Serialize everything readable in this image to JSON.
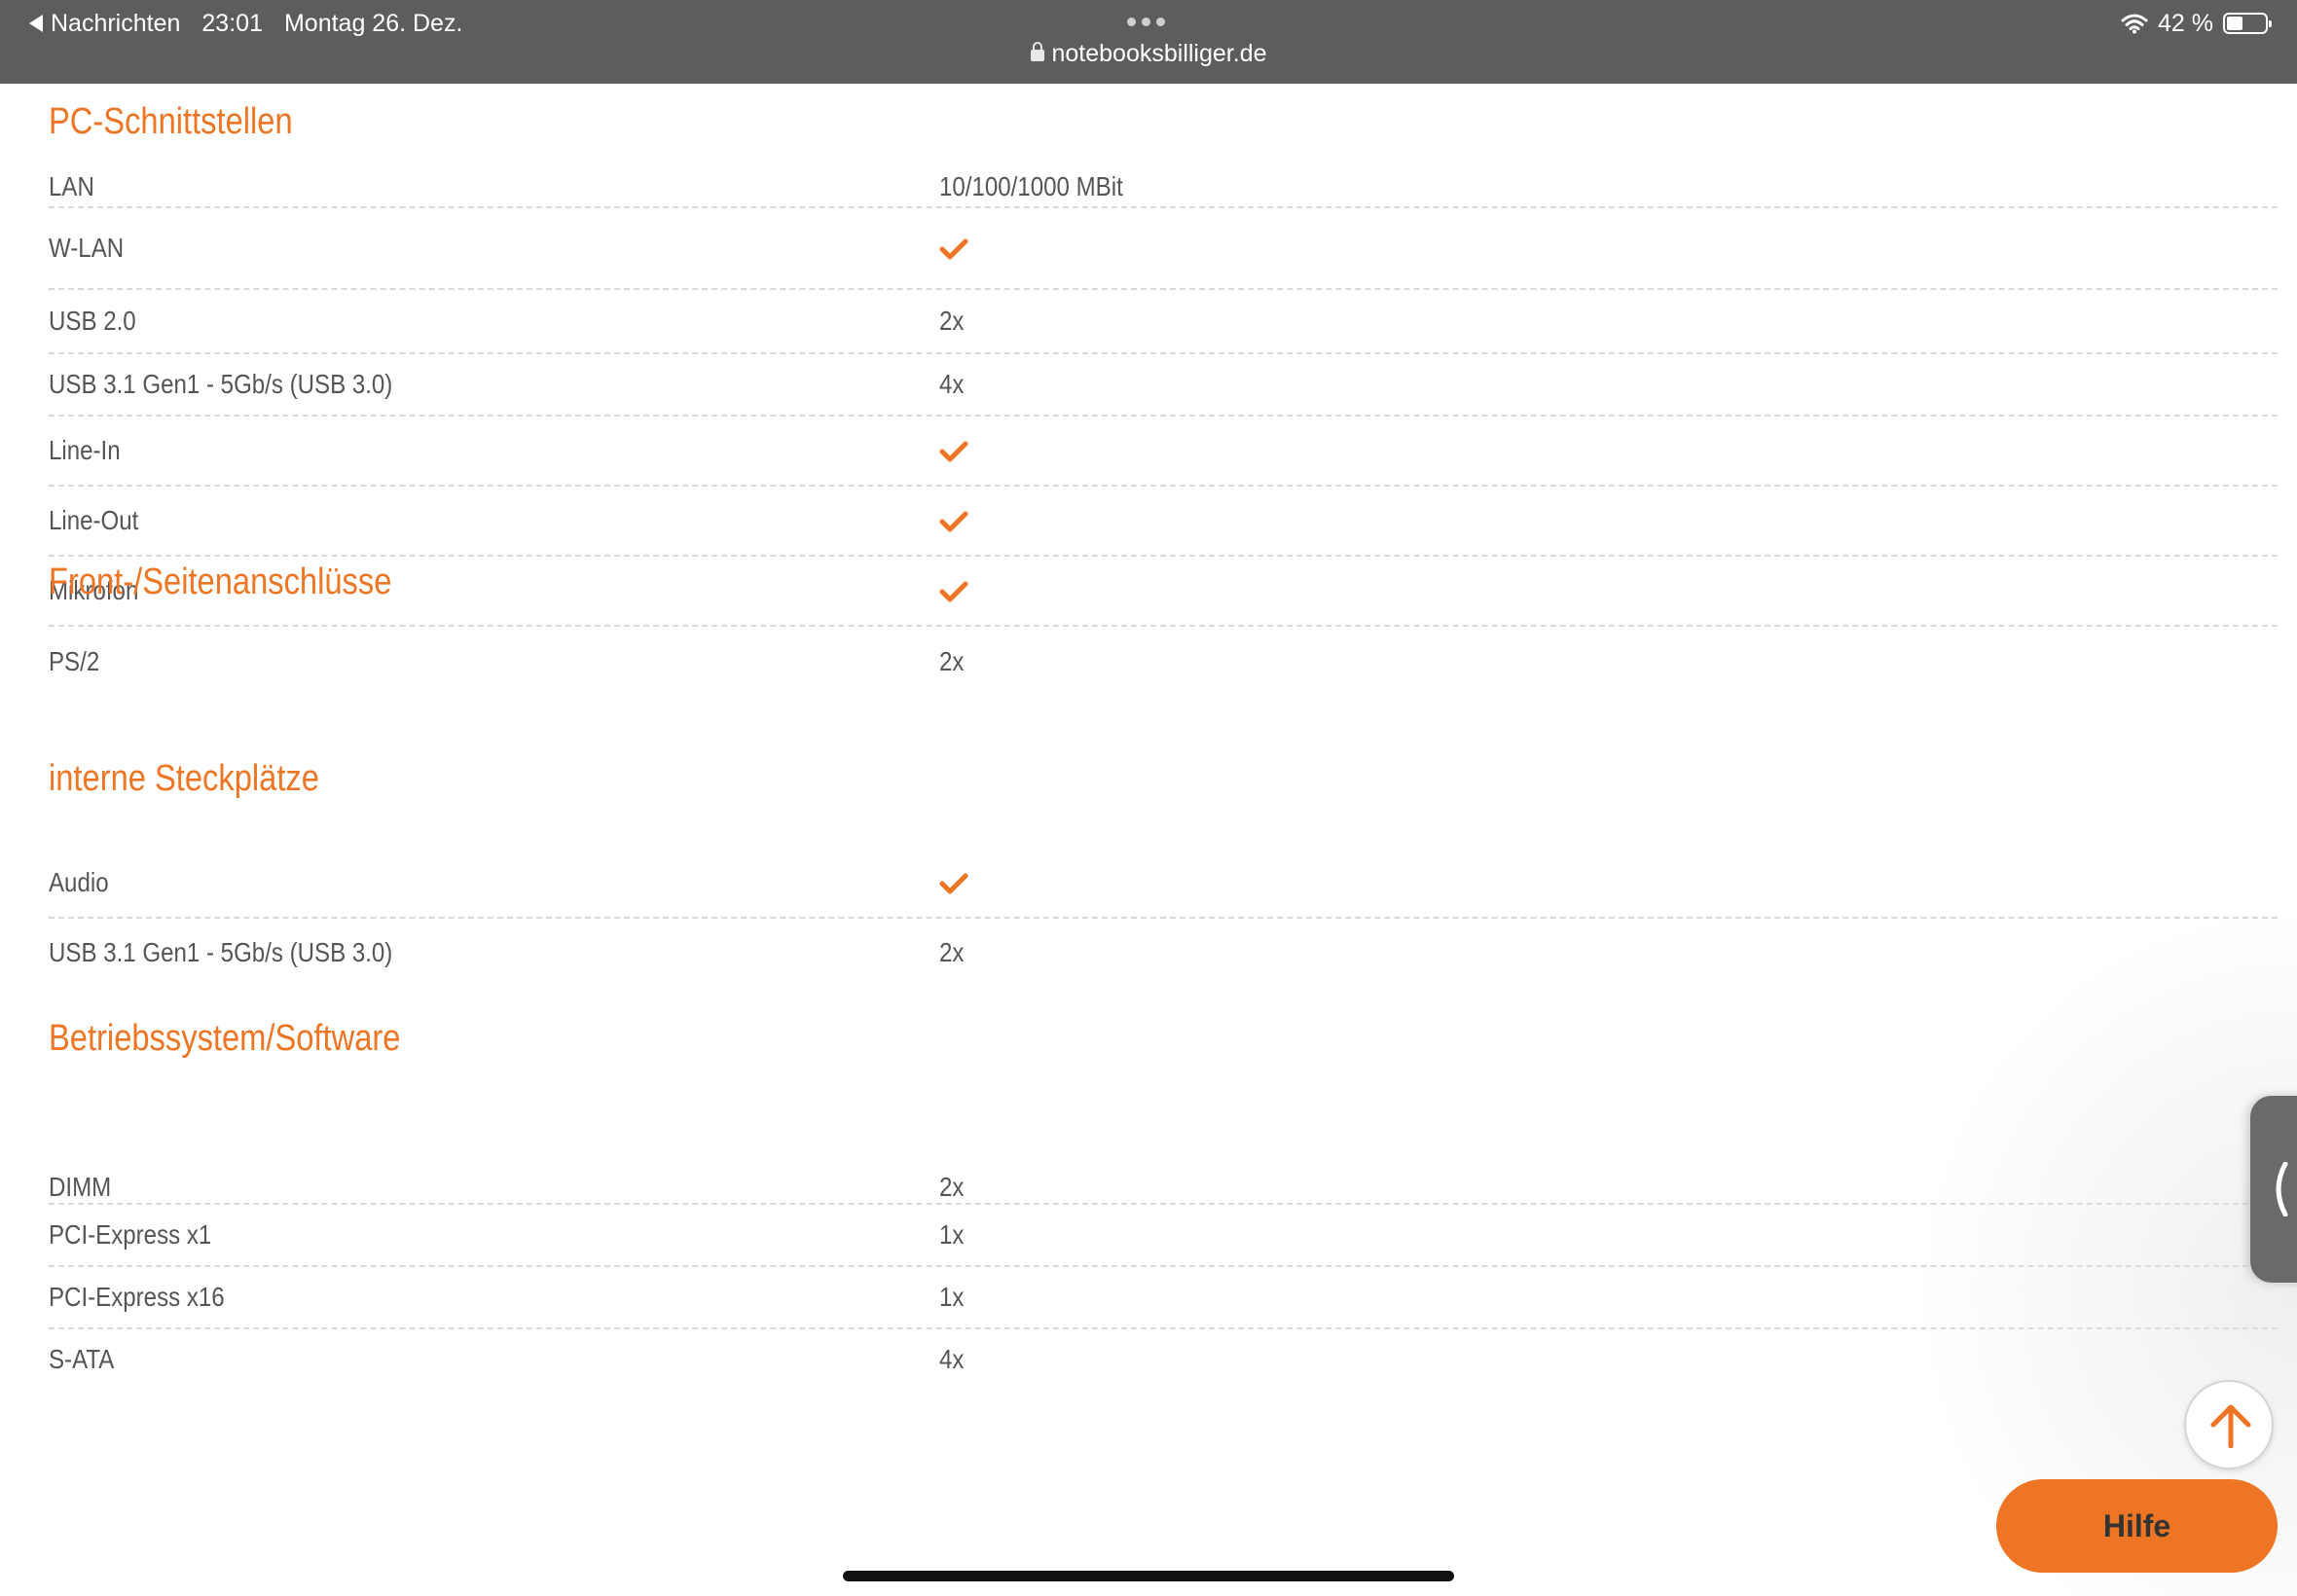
{
  "status_bar": {
    "back_label": "Nachrichten",
    "time": "23:01",
    "date": "Montag 26. Dez.",
    "battery": "42 %",
    "battery_level": 0.42
  },
  "url_bar": {
    "domain": "notebooksbilliger.de"
  },
  "accent_color": "#ee7523",
  "sections": [
    {
      "title": "PC-Schnittstellen",
      "rows": [
        {
          "label": "LAN",
          "value": "10/100/1000 MBit"
        },
        {
          "label": "W-LAN",
          "value": "check"
        },
        {
          "label": "USB 2.0",
          "value": "2x"
        },
        {
          "label": "USB 3.1 Gen1 - 5Gb/s (USB 3.0)",
          "value": "4x"
        },
        {
          "label": "Line-In",
          "value": "check"
        },
        {
          "label": "Line-Out",
          "value": "check"
        },
        {
          "label": "Mikrofon",
          "value": "check"
        },
        {
          "label": "PS/2",
          "value": "2x"
        }
      ]
    },
    {
      "title": "Front-/Seitenanschlüsse",
      "rows": [
        {
          "label": "Audio",
          "value": "check"
        },
        {
          "label": "USB 3.1 Gen1 - 5Gb/s (USB 3.0)",
          "value": "2x"
        }
      ]
    },
    {
      "title": "interne Steckplätze",
      "rows": [
        {
          "label": "DIMM",
          "value": "2x"
        },
        {
          "label": "PCI-Express x1",
          "value": "1x"
        },
        {
          "label": "PCI-Express x16",
          "value": "1x"
        },
        {
          "label": "S-ATA",
          "value": "4x"
        }
      ]
    },
    {
      "title": "Betriebssystem/Software",
      "rows": []
    }
  ],
  "icons": {
    "check": "checkmark-icon",
    "back": "back-arrow-icon",
    "lock": "lock-icon",
    "wifi": "wifi-icon",
    "battery": "battery-icon",
    "side_tab": "chevron-left-icon",
    "to_top": "arrow-up-icon"
  },
  "help_button": {
    "label": "Hilfe"
  }
}
